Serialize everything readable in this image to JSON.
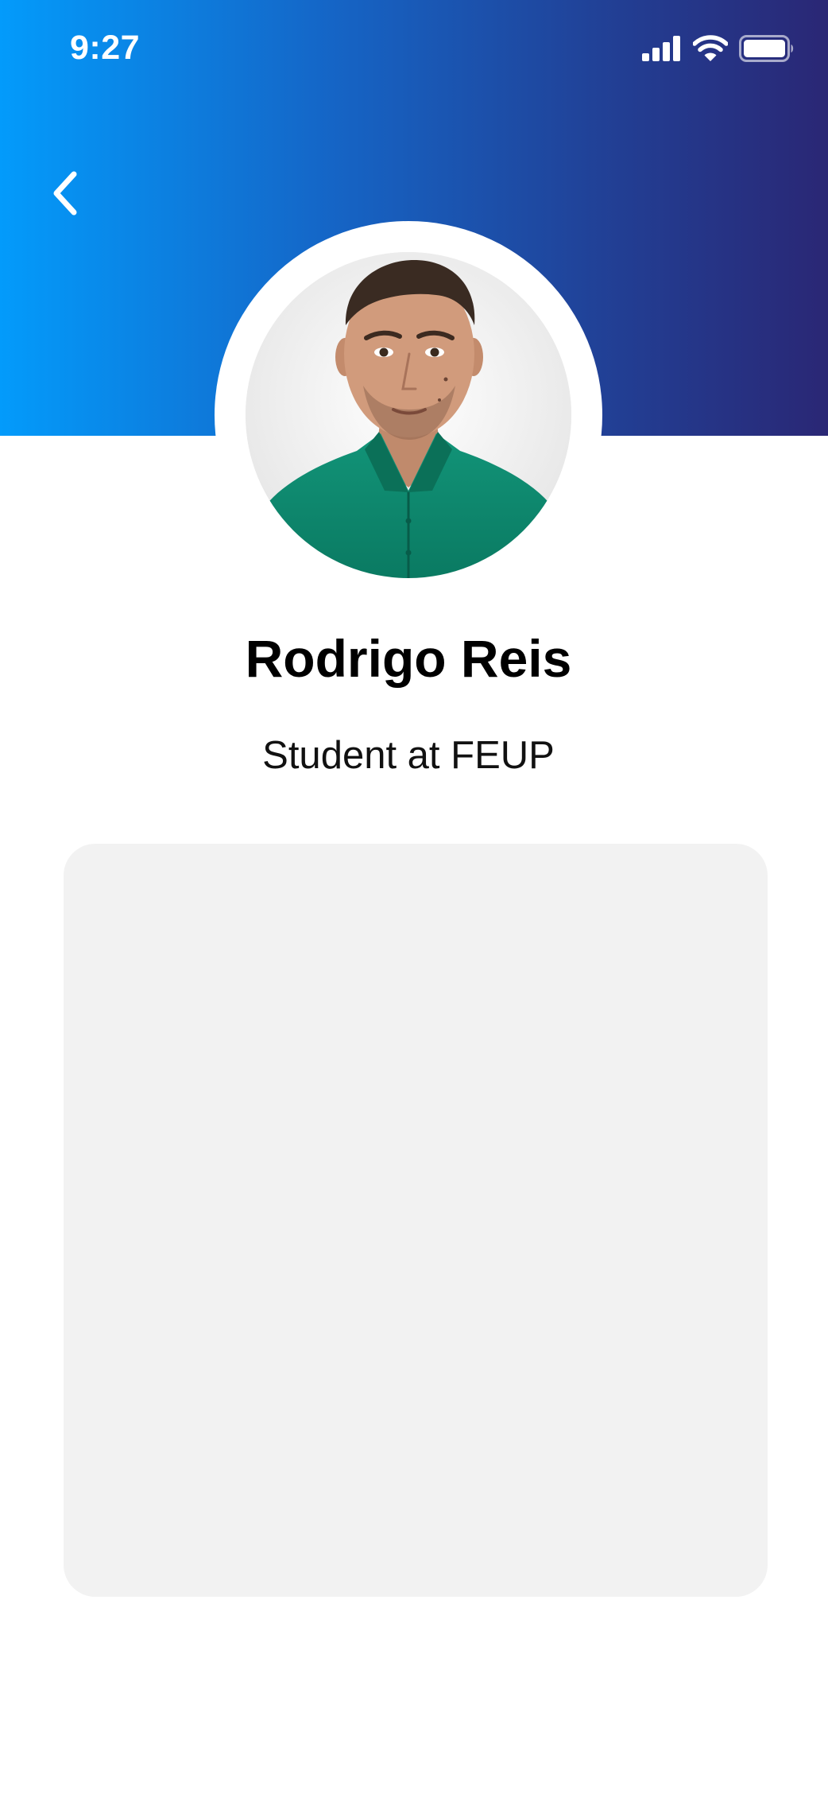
{
  "status_bar": {
    "time": "9:27",
    "icons": [
      "cellular-signal-icon",
      "wifi-icon",
      "battery-icon"
    ]
  },
  "header": {
    "back_icon": "chevron-left-icon",
    "gradient": [
      "#039bfb",
      "#1565c6",
      "#223e93",
      "#2a2775"
    ]
  },
  "profile": {
    "name": "Rodrigo Reis",
    "subtitle": "Student at FEUP",
    "shirt_color": "#0f8a72"
  },
  "content_card": {
    "background": "#f2f2f2"
  }
}
